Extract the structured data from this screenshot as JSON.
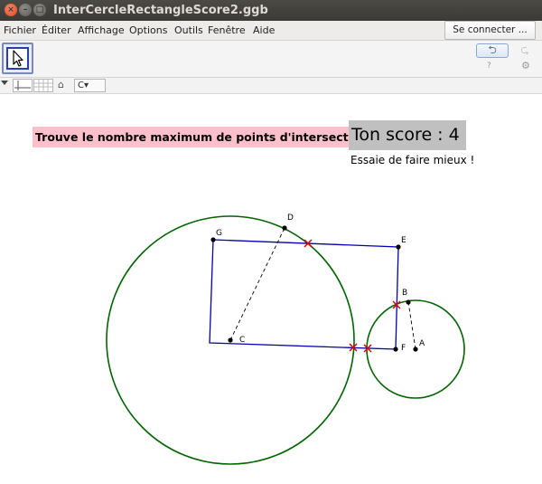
{
  "window": {
    "title": "InterCercleRectangleScore2.ggb",
    "close_glyph": "×",
    "minimize_glyph": "–",
    "maximize_glyph": "□"
  },
  "menu": {
    "items": [
      "Fichier",
      "Éditer",
      "Affichage",
      "Options",
      "Outils",
      "Fenêtre",
      "Aide"
    ],
    "connect_label": "Se connecter ..."
  },
  "toolbar": {
    "active_tool_icon": "move-arrow-icon",
    "undo_glyph": "⮌",
    "redo_glyph": "⮎",
    "help_glyph": "?",
    "settings_glyph": "⚙"
  },
  "stylebar": {
    "home_glyph": "⌂",
    "dropdown_value": "C▾"
  },
  "graphics": {
    "instruction": "Trouve le nombre maximum de points d'intersection entre un cercle et un rectangle",
    "score_text": "Ton score : 4",
    "hint_text": "Essaie de faire mieux !",
    "colors": {
      "circle": "#006400",
      "rectangle": "#0000b4",
      "intersection": "#e00000",
      "instruction_bg": "#ffc0cb",
      "score_bg": "#c0c0c0"
    },
    "points": [
      {
        "label": "G"
      },
      {
        "label": "E"
      },
      {
        "label": "D"
      },
      {
        "label": "C"
      },
      {
        "label": "B"
      },
      {
        "label": "A"
      },
      {
        "label": "F"
      }
    ]
  }
}
